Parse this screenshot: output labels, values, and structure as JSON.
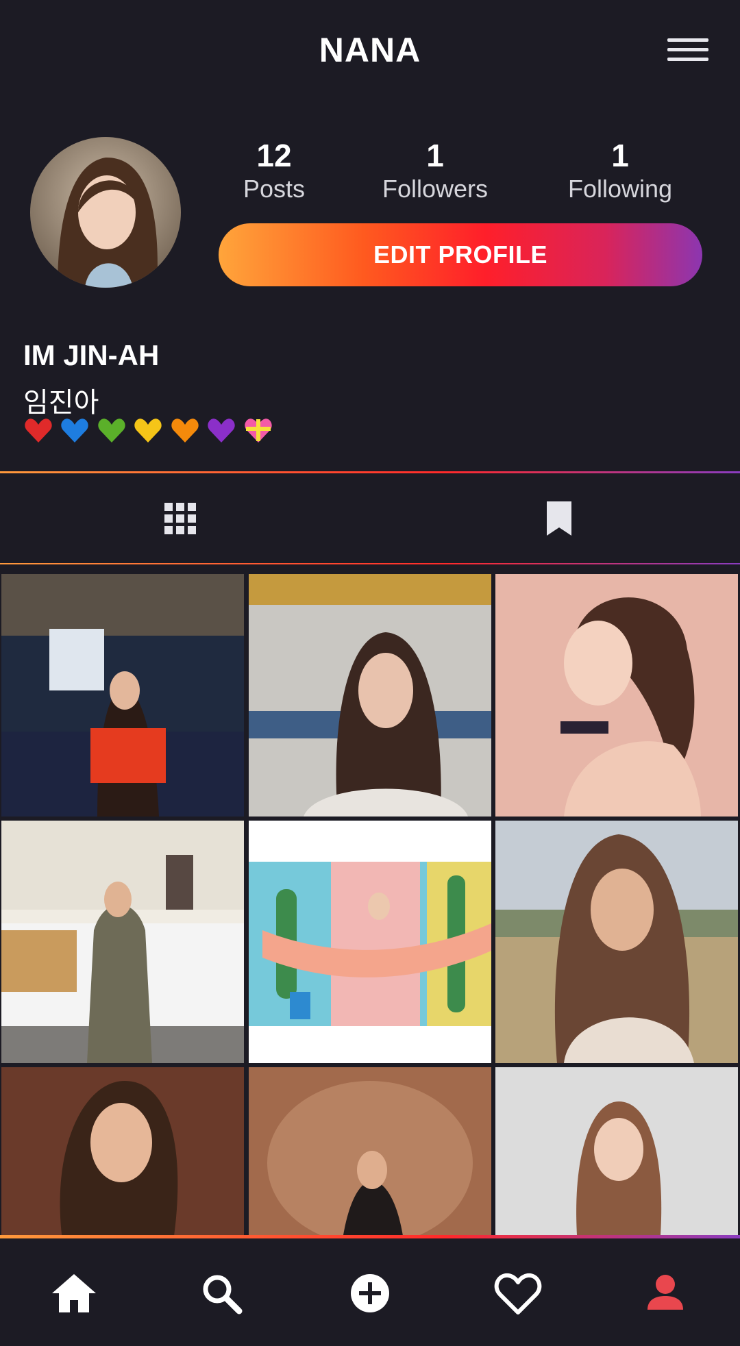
{
  "header": {
    "title": "NANA",
    "menu_icon": "hamburger-menu-icon"
  },
  "profile": {
    "avatar_alt": "profile-photo",
    "stats": [
      {
        "value": "12",
        "label": "Posts"
      },
      {
        "value": "1",
        "label": "Followers"
      },
      {
        "value": "1",
        "label": "Following"
      }
    ],
    "edit_button": "EDIT PROFILE",
    "name": "IM JIN-AH",
    "subname": "임진아",
    "hearts": [
      "red-heart",
      "blue-heart",
      "green-heart",
      "yellow-heart",
      "orange-heart",
      "purple-heart",
      "heart-with-ribbon"
    ]
  },
  "tabs": [
    {
      "icon": "grid-icon",
      "active": true
    },
    {
      "icon": "bookmark-icon",
      "active": false
    }
  ],
  "posts": [
    {
      "desc": "photo-1"
    },
    {
      "desc": "photo-2"
    },
    {
      "desc": "photo-3"
    },
    {
      "desc": "photo-4"
    },
    {
      "desc": "photo-5"
    },
    {
      "desc": "photo-6"
    },
    {
      "desc": "photo-7"
    },
    {
      "desc": "photo-8"
    },
    {
      "desc": "photo-9"
    }
  ],
  "bottom_nav": [
    {
      "icon": "home-icon"
    },
    {
      "icon": "search-icon"
    },
    {
      "icon": "add-post-icon"
    },
    {
      "icon": "heart-icon"
    },
    {
      "icon": "profile-icon",
      "active": true
    }
  ],
  "colors": {
    "background": "#1c1b24",
    "accent_gradient_start": "#ffa53b",
    "accent_gradient_mid": "#ff1f2a",
    "accent_gradient_end": "#8c36b0",
    "active_nav": "#e9474e"
  }
}
